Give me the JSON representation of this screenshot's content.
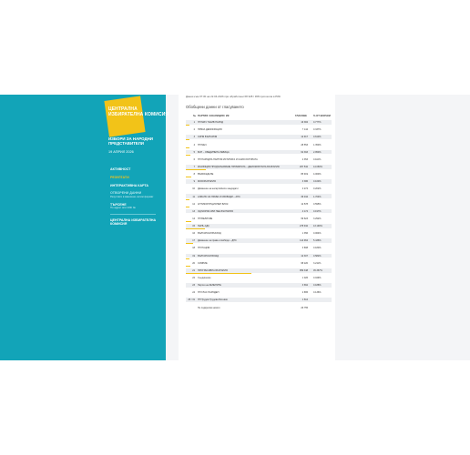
{
  "logo": {
    "text": "ЦЕНТРАЛНА ИЗБИРАТЕЛНА КОМИСИЯ"
  },
  "election": {
    "title": "ИЗБОРИ ЗА НАРОДНИ ПРЕДСТАВИТЕЛИ",
    "date": "19 АПРИЛ 2026"
  },
  "nav": {
    "items": [
      {
        "label": "АКТИВНОСТ"
      },
      {
        "label": "РЕЗУЛТАТИ"
      },
      {
        "label": "ИНТЕРАКТИВНА КАРТА"
      },
      {
        "label": "ОТВОРЕНИ ДАННИ",
        "sub": "Резултати в машинно-четим формат"
      },
      {
        "label": "ТЪРСЕНЕ",
        "sub": "По адрес или СИК №"
      }
    ],
    "footer": "ЦЕНТРАЛНА ИЗБИРАТЕЛНА КОМИСИЯ"
  },
  "content": {
    "source_note": "Данни към 07:30 на 22.04.2026 при обработени 68 328 / 368 протокола в РИК",
    "section_title": "Обобщени данни от гласуването",
    "table_headers": {
      "num": "№",
      "name": "ПАРТИЯ / КОАЛИЦИЯ / ИК",
      "votes": "ГЛАСОВЕ",
      "pct": "% ОТ ВСИЧКИ"
    }
  },
  "rows": [
    {
      "num": "1",
      "name": "ПП МИЧ ТАКИВ НАРОД",
      "votes": "16 384",
      "pct": "0.777%",
      "bar": 0.01
    },
    {
      "num": "2",
      "name": "ПРЯКА ДЕМОКРАЦИЯ",
      "votes": "7 144",
      "pct": "0.337%",
      "bar": 0
    },
    {
      "num": "3",
      "name": "СИНЯ БЪЛГАРИЯ",
      "votes": "12 917",
      "pct": "0.610%",
      "bar": 0.01
    },
    {
      "num": "4",
      "name": "ПП МЕЧ",
      "votes": "28 553",
      "pct": "1.350%",
      "bar": 0.02
    },
    {
      "num": "5",
      "name": "БСП – ОБЕДИНЕНА ЛЕВИЦА",
      "votes": "62 393",
      "pct": "2.950%",
      "bar": 0.03
    },
    {
      "num": "6",
      "name": "ПП НАРОДНА ПАРТИЯ ИСТИНАТА И САМО ИСТИНАТА",
      "votes": "2 353",
      "pct": "0.110%",
      "bar": 0
    },
    {
      "num": "7",
      "name": "КОАЛИЦИЯ ПРОДЪЛЖАВАМЕ ПРОМЯНАТА – ДЕМОКРАТИЧНА БЪЛГАРИЯ",
      "votes": "297 542",
      "pct": "14.060%",
      "bar": 0.14
    },
    {
      "num": "8",
      "name": "ВЪЗРАЖДАНЕ",
      "votes": "85 919",
      "pct": "4.060%",
      "bar": 0.04
    },
    {
      "num": "9",
      "name": "МОЯ БЪЛГАРИЯ",
      "votes": "3 386",
      "pct": "0.160%",
      "bar": 0
    },
    {
      "num": "10",
      "name": "Движение на непартийните кандидати",
      "votes": "4 274",
      "pct": "0.202%",
      "bar": 0
    },
    {
      "num": "11",
      "name": "АЛИАНС ЗА ПРАВА И СВОБОДИ – АПС",
      "votes": "36 044",
      "pct": "1.704%",
      "bar": 0.02
    },
    {
      "num": "12",
      "name": "АНТИКОРУПЦИОНЕН БЛОК",
      "votes": "12 578",
      "pct": "0.595%",
      "bar": 0.01
    },
    {
      "num": "13",
      "name": "ОД МОРЯК ИЛИ НЕЕ БЪЛГАРИЯ",
      "votes": "4 174",
      "pct": "0.197%",
      "bar": 0
    },
    {
      "num": "14",
      "name": "ПП ВЕЛИЧИЕ",
      "votes": "69 623",
      "pct": "3.292%",
      "bar": 0.04
    },
    {
      "num": "15",
      "name": "ГЕРБ–СДС",
      "votes": "278 942",
      "pct": "13.190%",
      "bar": 0.13
    },
    {
      "num": "16",
      "name": "БЪЛГАРСКИ ВЪЗХОД",
      "votes": "1 356",
      "pct": "0.064%",
      "bar": 0
    },
    {
      "num": "17",
      "name": "Движение за права и свободи – ДПС",
      "votes": "114 964",
      "pct": "5.436%",
      "bar": 0.05
    },
    {
      "num": "18",
      "name": "ПП НАЦИЯ",
      "votes": "3 808",
      "pct": "0.180%",
      "bar": 0
    },
    {
      "num": "19",
      "name": "БЪЛГАРСКИ ВОЖД",
      "votes": "12 307",
      "pct": "0.582%",
      "bar": 0.01
    },
    {
      "num": "20",
      "name": "СИЯНИЕ",
      "votes": "68 220",
      "pct": "3.211%",
      "bar": 0.03
    },
    {
      "num": "21",
      "name": "ПРОГРЕСИВНА БЪЛГАРИЯ",
      "votes": "959 348",
      "pct": "45.367%",
      "bar": 0.45
    },
    {
      "num": "22",
      "name": "Съединение",
      "votes": "1 026",
      "pct": "0.049%",
      "bar": 0
    },
    {
      "num": "23",
      "name": "Партия на ЗЕЛЕНИТЕ",
      "votes": "3 662",
      "pct": "0.188%",
      "bar": 0
    },
    {
      "num": "24",
      "name": "ПП ГЛАС НАРОДЕН",
      "votes": "2 865",
      "pct": "0.136%",
      "bar": 0
    },
    {
      "num": "25 / 31",
      "name": "ПП Трудов Трудова Ботевия",
      "votes": "1 612",
      "pct": "",
      "bar": 0
    },
    {
      "num": "",
      "name": "Не подкрепям никого",
      "votes": "26 755",
      "pct": "",
      "bar": 0
    }
  ]
}
